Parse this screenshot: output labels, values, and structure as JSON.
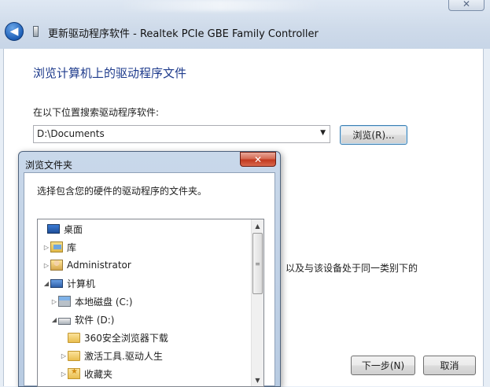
{
  "window": {
    "title": "更新驱动程序软件 - Realtek PCIe GBE Family Controller",
    "close_glyph": "✕",
    "back_glyph": "◀"
  },
  "wizard": {
    "heading": "浏览计算机上的驱动程序文件",
    "search_label": "在以下位置搜索驱动程序软件:",
    "path_value": "D:\\Documents",
    "browse_label": "浏览(R)...",
    "background_text": "以及与该设备处于同一类别下的",
    "next_label": "下一步(N)",
    "cancel_label": "取消"
  },
  "browse_dialog": {
    "title": "浏览文件夹",
    "close_glyph": "✕",
    "description": "选择包含您的硬件的驱动程序的文件夹。",
    "tree": [
      {
        "label": "桌面",
        "icon": "desktop-icon",
        "expander": ""
      },
      {
        "label": "库",
        "icon": "library-icon",
        "expander": "▷"
      },
      {
        "label": "Administrator",
        "icon": "user-folder-icon",
        "expander": "▷"
      },
      {
        "label": "计算机",
        "icon": "computer-icon",
        "expander": "◢"
      },
      {
        "label": "本地磁盘 (C:)",
        "icon": "os-drive-icon",
        "expander": "▷"
      },
      {
        "label": "软件 (D:)",
        "icon": "drive-icon",
        "expander": "◢"
      },
      {
        "label": "360安全浏览器下载",
        "icon": "folder-icon",
        "expander": ""
      },
      {
        "label": "激活工具.驱动人生",
        "icon": "folder-icon",
        "expander": "▷"
      },
      {
        "label": "收藏夹",
        "icon": "favorites-folder-icon",
        "expander": "▷"
      }
    ]
  },
  "colors": {
    "heading": "#1e3b8c",
    "dialog_close": "#c2391f",
    "browse_focus": "#3c7fb1"
  }
}
